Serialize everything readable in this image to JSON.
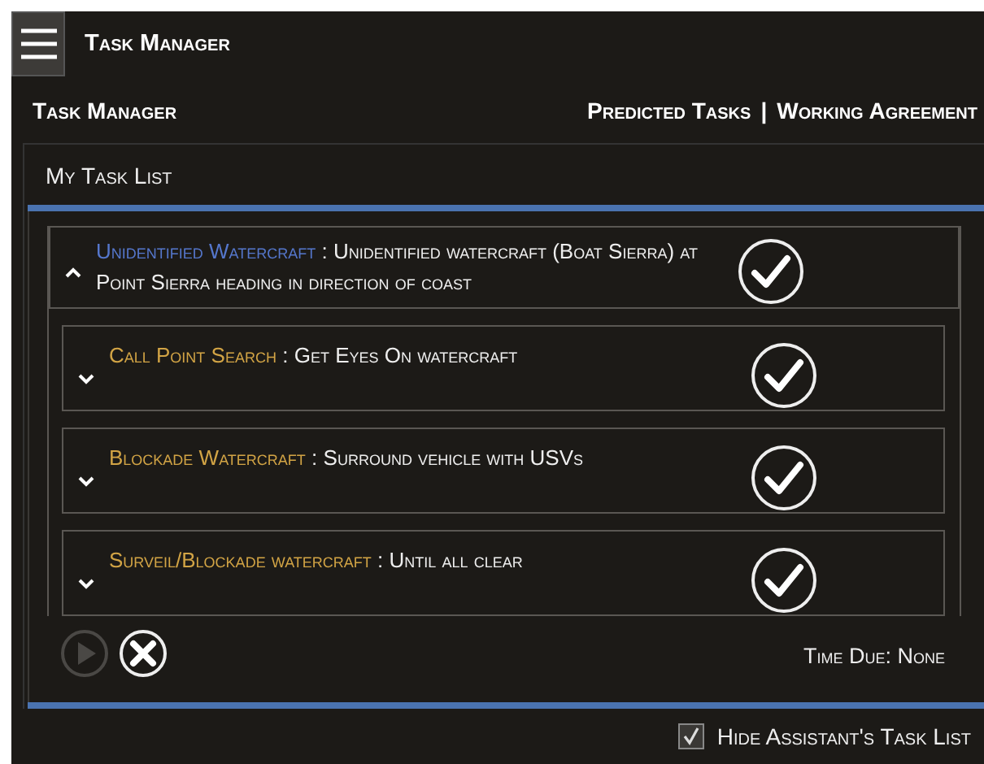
{
  "window": {
    "title": "Task Manager"
  },
  "subheader": {
    "title": "Task Manager",
    "links": [
      "Predicted Tasks",
      "Working Agreement"
    ],
    "separator": "|"
  },
  "panel": {
    "title": "My Task List"
  },
  "task": {
    "name": "Unidentified Watercraft",
    "separator": ":",
    "description": "Unidentified watercraft (Boat Sierra) at Point Sierra heading in direction of coast",
    "expanded": true,
    "subtasks": [
      {
        "name": "Call Point Search",
        "separator": ":",
        "description": "Get Eyes On watercraft",
        "expanded": false
      },
      {
        "name": "Blockade Watercraft",
        "separator": ":",
        "description": "Surround vehicle with USVs",
        "expanded": false
      },
      {
        "name": "Surveil/Blockade watercraft",
        "separator": ":",
        "description": "Until all clear",
        "expanded": false
      }
    ]
  },
  "actions": {
    "play": {
      "disabled": true
    },
    "time_due": "Time Due: None"
  },
  "hide_assistant": {
    "label": "Hide Assistant's Task List",
    "checked": true
  }
}
